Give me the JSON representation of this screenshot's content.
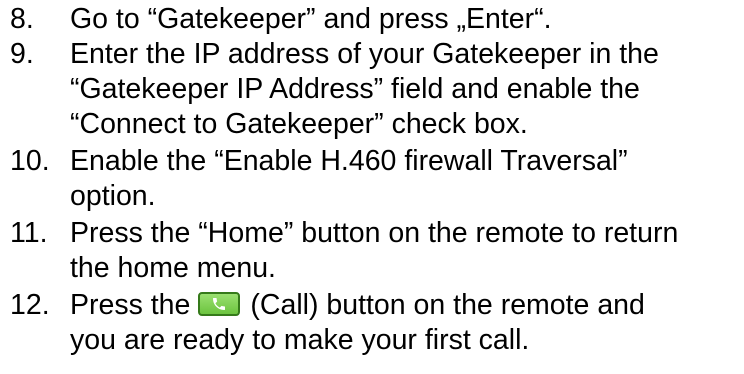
{
  "steps": [
    {
      "number": "8.",
      "lines": [
        "Go to “Gatekeeper” and press „Enter“."
      ]
    },
    {
      "number": "9.",
      "lines": [
        "Enter the IP address of your Gatekeeper in the",
        "“Gatekeeper IP Address” field and enable the",
        "“Connect to Gatekeeper” check box."
      ]
    },
    {
      "number": "10.",
      "lines": [
        "Enable the “Enable H.460 firewall Traversal”",
        "option."
      ]
    },
    {
      "number": "11.",
      "lines": [
        "Press the “Home” button on the remote to return",
        "the home menu."
      ]
    },
    {
      "number": "12.",
      "line1_before_icon": "Press the",
      "line1_after_icon": "(Call) button on the remote and",
      "line2": "you are ready to make your first call.",
      "icon": "phone-call-icon",
      "icon_color": "#6cc43f"
    }
  ]
}
